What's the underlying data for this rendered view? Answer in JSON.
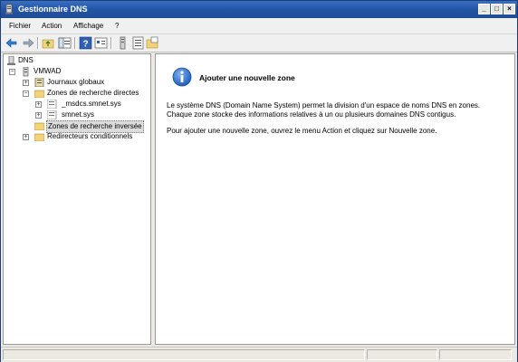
{
  "window": {
    "title": "Gestionnaire DNS"
  },
  "menu": {
    "items": [
      "Fichier",
      "Action",
      "Affichage",
      "?"
    ]
  },
  "toolbar": {
    "icons": [
      "back-arrow-icon",
      "forward-arrow-icon",
      "up-folder-icon",
      "show-hide-tree-icon",
      "help-icon",
      "properties-icon",
      "server-icon",
      "list-icon",
      "folder-export-icon"
    ]
  },
  "tree": {
    "root": "DNS",
    "server": "VMWAD",
    "items": [
      "Journaux globaux",
      "Zones de recherche directes",
      "_msdcs.smnet.sys",
      "smnet.sys",
      "Zones de recherche inversée",
      "Redirecteurs conditionnels"
    ],
    "selected": "Zones de recherche inversée"
  },
  "content": {
    "heading": "Ajouter une nouvelle zone",
    "para1_line1": "Le système DNS (Domain Name System) permet la division d'un espace de noms DNS en zones.",
    "para1_line2": "Chaque zone stocke des informations relatives à un ou plusieurs domaines DNS contigus.",
    "para2": "Pour ajouter une nouvelle zone, ouvrez le menu Action et cliquez sur Nouvelle zone."
  },
  "colors": {
    "titlebar": "#2457a7",
    "info_icon": "#1f5fbf",
    "folder": "#f3d37a"
  }
}
